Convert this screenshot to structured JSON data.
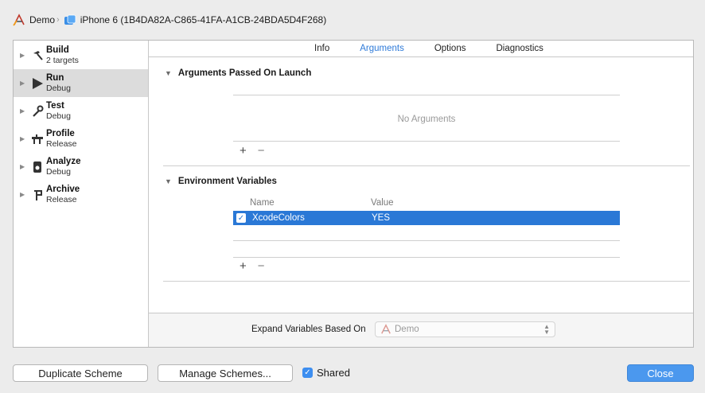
{
  "breadcrumb": {
    "project": "Demo",
    "device": "iPhone 6 (1B4DA82A-C865-41FA-A1CB-24BDA5D4F268)"
  },
  "sidebar": {
    "items": [
      {
        "title": "Build",
        "subtitle": "2 targets",
        "icon": "hammer-icon"
      },
      {
        "title": "Run",
        "subtitle": "Debug",
        "icon": "play-icon",
        "selected": true
      },
      {
        "title": "Test",
        "subtitle": "Debug",
        "icon": "wrench-icon"
      },
      {
        "title": "Profile",
        "subtitle": "Release",
        "icon": "instruments-icon"
      },
      {
        "title": "Analyze",
        "subtitle": "Debug",
        "icon": "analyze-icon"
      },
      {
        "title": "Archive",
        "subtitle": "Release",
        "icon": "archive-icon"
      }
    ]
  },
  "tabs": [
    {
      "label": "Info"
    },
    {
      "label": "Arguments",
      "active": true
    },
    {
      "label": "Options"
    },
    {
      "label": "Diagnostics"
    }
  ],
  "arguments_section": {
    "title": "Arguments Passed On Launch",
    "empty_text": "No Arguments"
  },
  "env_section": {
    "title": "Environment Variables",
    "col_name": "Name",
    "col_value": "Value",
    "rows": [
      {
        "enabled": true,
        "name": "XcodeColors",
        "value": "YES"
      }
    ]
  },
  "expand": {
    "label": "Expand Variables Based On",
    "selected": "Demo"
  },
  "footer": {
    "duplicate": "Duplicate Scheme",
    "manage": "Manage Schemes...",
    "shared_label": "Shared",
    "shared_checked": true,
    "close": "Close"
  },
  "colors": {
    "accent": "#2a78d6",
    "tab_active": "#2f7bd9",
    "close_button": "#4b98ee"
  }
}
